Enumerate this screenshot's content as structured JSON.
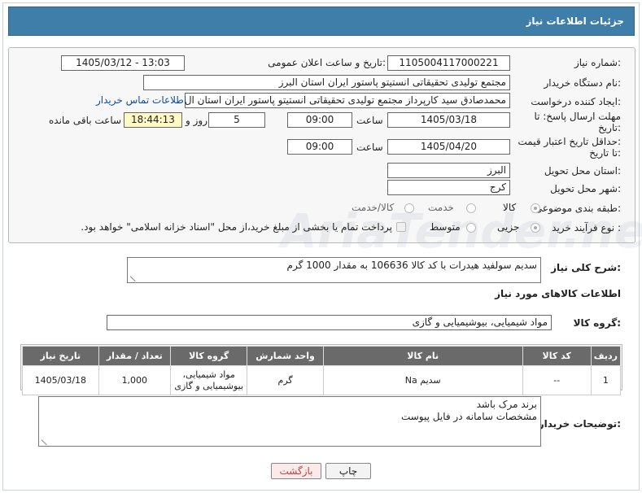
{
  "header": {
    "title": "جزئیات اطلاعات نیاز"
  },
  "form": {
    "need_number": {
      "label": "شماره نیاز:",
      "value": "1105004117000221"
    },
    "announce_datetime": {
      "label": "تاریخ و ساعت اعلان عمومی:",
      "value": "1405/03/12 - 13:03"
    },
    "buyer_org": {
      "label": "نام دستگاه خریدار:",
      "value": "مجتمع تولیدی تحقیقاتی انستیتو پاستور ایران استان البرز"
    },
    "requester": {
      "label": "ایجاد کننده درخواست:",
      "value": "محمدصادق سید کارپرداز مجتمع تولیدی تحقیقاتی انستیتو پاستور ایران استان ال"
    },
    "contact_link": "اطلاعات تماس خریدار",
    "reply_deadline": {
      "label_line1": "مهلت ارسال پاسخ: تا",
      "label_line2": "تاریخ:",
      "date": "1405/03/18",
      "time_label": "ساعت",
      "time": "09:00",
      "days": "5",
      "days_label": "روز و",
      "remaining": "18:44:13",
      "remaining_label": "ساعت باقی مانده"
    },
    "price_validity": {
      "label_line1": "حداقل تاریخ اعتبار قیمت:",
      "label_line2": "تا تاریخ:",
      "date": "1405/04/20",
      "time_label": "ساعت",
      "time": "09:00"
    },
    "delivery_province": {
      "label": "استان محل تحویل:",
      "value": "البرز"
    },
    "delivery_city": {
      "label": "شهر محل تحویل:",
      "value": "کرج"
    },
    "category": {
      "label": "طبقه بندی موضوعی:",
      "options": [
        "کالا",
        "خدمت",
        "کالا/خدمت"
      ]
    },
    "purchase_type": {
      "label": "نوع فرآیند خرید :",
      "options": [
        "جزیی",
        "متوسط"
      ],
      "payment_note": "پرداخت تمام یا بخشی از مبلغ خرید،از محل \"اسناد خزانه اسلامی\" خواهد بود."
    }
  },
  "summary": {
    "label": "شرح کلی نیاز:",
    "value": "سدیم سولفید هیدرات با کد کالا 106636 به مقدار 1000 گرم"
  },
  "goods_info": {
    "title": "اطلاعات کالاهای مورد نیاز",
    "group_label": "گروه کالا:",
    "group_value": "مواد شیمیایی، بیوشیمیایی و  گازی"
  },
  "table": {
    "headers": [
      "ردیف",
      "کد کالا",
      "نام کالا",
      "واحد شمارش",
      "گروه کالا",
      "تعداد / مقدار",
      "تاریخ نیاز"
    ],
    "rows": [
      [
        "1",
        "--",
        "سدیم Na",
        "گرم",
        "مواد شیمیایی، بیوشیمیایی و گازی",
        "1,000",
        "1405/03/18"
      ]
    ]
  },
  "buyer_notes": {
    "label": "توضیحات خریدار:",
    "lines": [
      "برند مرک باشد",
      "مشخصات سامانه در فایل پیوست"
    ]
  },
  "buttons": {
    "print": "چاپ",
    "back": "بازگشت"
  },
  "watermark": {
    "text": "AriaTender.net"
  }
}
